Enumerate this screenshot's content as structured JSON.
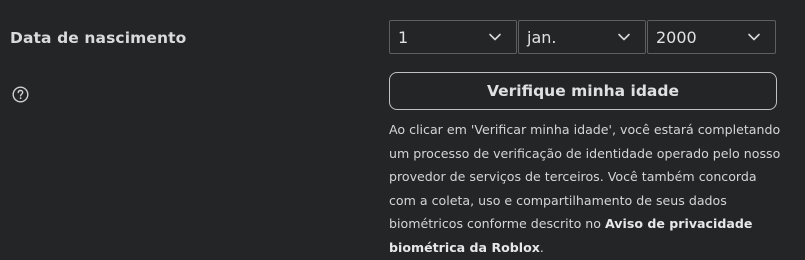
{
  "birthdate": {
    "label": "Data de nascimento",
    "day": "1",
    "month": "jan.",
    "year": "2000"
  },
  "verify": {
    "button_label": "Verifique minha idade",
    "disclaimer_text": "Ao clicar em 'Verificar minha idade', você estará completando um processo de verificação de identidade operado pelo nosso provedor de serviços de terceiros. Você também concorda com a coleta, uso e compartilhamento de seus dados biométricos conforme descrito no ",
    "link_text": "Aviso de privacidade biométrica da Roblox",
    "trailing": "."
  },
  "icons": {
    "help": "help-circle-icon",
    "chevron": "chevron-down-icon"
  },
  "colors": {
    "background": "#232527",
    "text": "#e2e2e3",
    "border": "#5d5f61",
    "button_border": "#bfc1c3"
  }
}
